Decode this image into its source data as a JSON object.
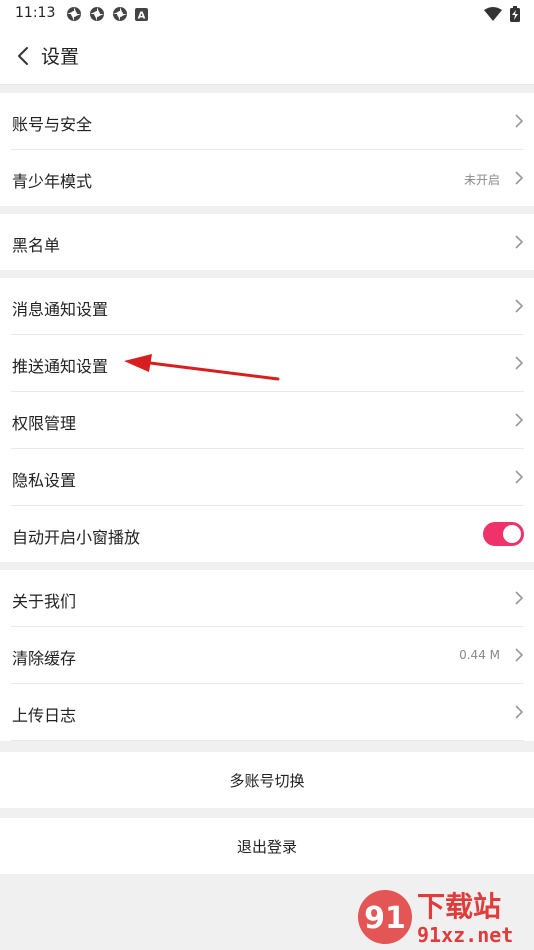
{
  "status_bar": {
    "time": "11:13",
    "left_icons": [
      "app-notification-icon",
      "app-notification-icon",
      "app-notification-icon",
      "text-a-icon"
    ],
    "right_icons": [
      "wifi-icon",
      "battery-charging-icon"
    ]
  },
  "header": {
    "title": "设置"
  },
  "groups": [
    {
      "rows": [
        {
          "label": "账号与安全",
          "value": ""
        },
        {
          "label": "青少年模式",
          "value": "未开启"
        }
      ]
    },
    {
      "rows": [
        {
          "label": "黑名单",
          "value": ""
        }
      ]
    },
    {
      "rows": [
        {
          "label": "消息通知设置",
          "value": ""
        },
        {
          "label": "推送通知设置",
          "value": ""
        },
        {
          "label": "权限管理",
          "value": ""
        },
        {
          "label": "隐私设置",
          "value": ""
        },
        {
          "label": "自动开启小窗播放",
          "toggle": true
        }
      ]
    },
    {
      "rows": [
        {
          "label": "关于我们",
          "value": ""
        },
        {
          "label": "清除缓存",
          "value": "0.44 M"
        },
        {
          "label": "上传日志",
          "value": ""
        }
      ]
    }
  ],
  "actions": {
    "switch_account": "多账号切换",
    "logout": "退出登录"
  },
  "colors": {
    "accent": "#f0326a",
    "annotation_arrow": "#d81e1e"
  },
  "watermark": {
    "text_top": "下载站",
    "text_bottom": "91xz.net",
    "logo_text": "91"
  }
}
